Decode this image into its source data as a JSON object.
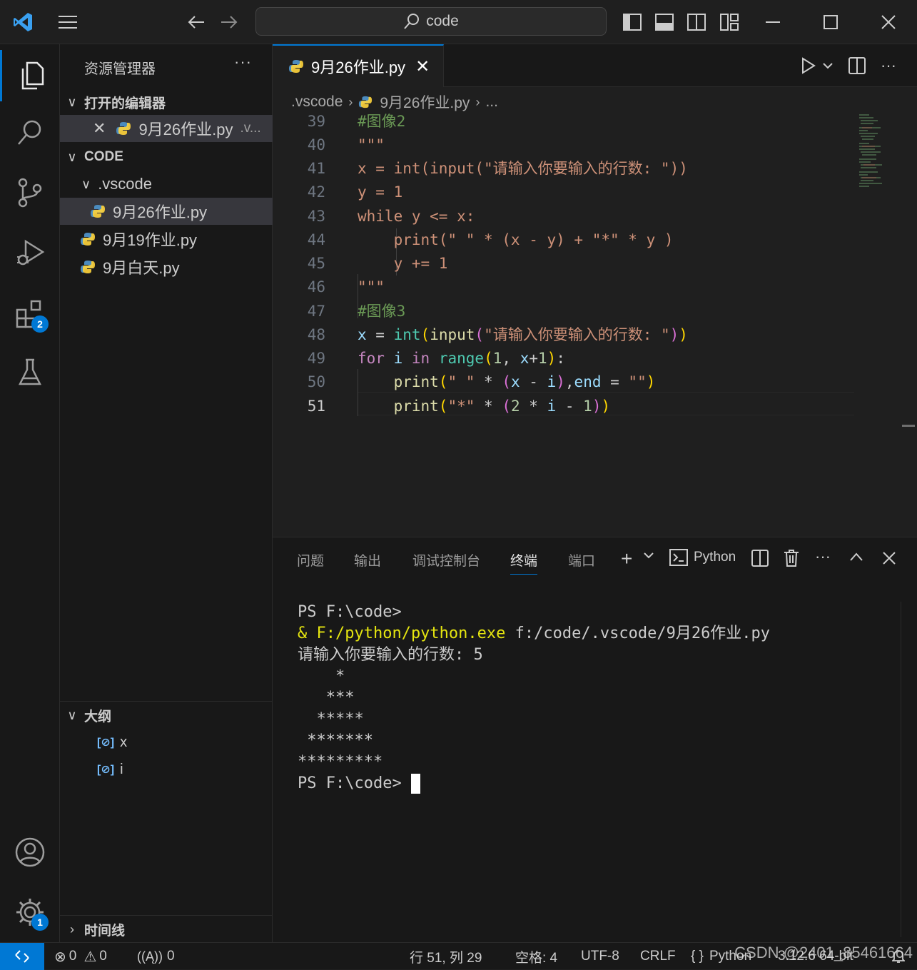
{
  "titlebar": {
    "search_text": "code"
  },
  "activity": {
    "extensions_badge": "2",
    "settings_badge": "1"
  },
  "sidebar": {
    "title": "资源管理器",
    "more": "···",
    "open_editors_label": "打开的编辑器",
    "open_editor_item": "9月26作业.py",
    "open_editor_path": ".v...",
    "workspace_label": "CODE",
    "folder_vscode": ".vscode",
    "files": [
      "9月26作业.py",
      "9月19作业.py",
      "9月白天.py"
    ],
    "outline_label": "大纲",
    "outline_items": [
      "x",
      "i"
    ],
    "timeline_label": "时间线"
  },
  "editor": {
    "tab_label": "9月26作业.py",
    "breadcrumb": [
      ".vscode",
      "9月26作业.py",
      "..."
    ],
    "line_numbers": [
      "39",
      "40",
      "41",
      "42",
      "43",
      "44",
      "45",
      "46",
      "47",
      "48",
      "49",
      "50",
      "51"
    ]
  },
  "panel": {
    "tabs": [
      "问题",
      "输出",
      "调试控制台",
      "终端",
      "端口"
    ],
    "active_tab": "终端",
    "shell_label": "Python",
    "terminal_lines": [
      "PS F:\\code>",
      "& F:/python/python.exe f:/code/.vscode/9月26作业.py",
      "请输入你要输入的行数: 5",
      "    *",
      "   ***",
      "  *****",
      " *******",
      "*********",
      "PS F:\\code> "
    ]
  },
  "statusbar": {
    "errors": "0",
    "warnings": "0",
    "ports": "0",
    "position": "行 51, 列 29",
    "spaces": "空格: 4",
    "encoding": "UTF-8",
    "eol": "CRLF",
    "language": "Python",
    "python_version": "3.12.6 64-bit"
  },
  "watermark": "CSDN @2401_85461664"
}
